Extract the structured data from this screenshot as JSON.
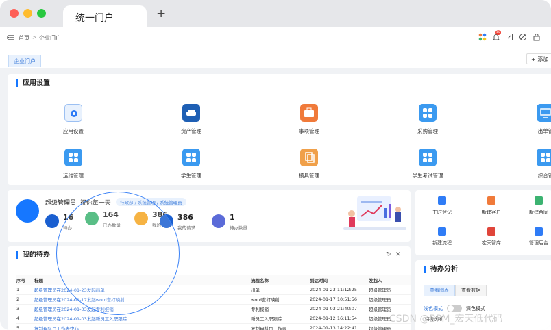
{
  "window": {
    "tab_title": "统一门户",
    "new_tab": "+"
  },
  "breadcrumb": {
    "home": "首页",
    "sep": ">",
    "current": "企业门户"
  },
  "topbar": {
    "notify_count": "98"
  },
  "page_tab": "企业门户",
  "add_button": "+ 添加",
  "app_settings": {
    "title": "应用设置",
    "apps": [
      {
        "label": "应用设置",
        "icon": "gear-icon",
        "color": "#e8f1fd"
      },
      {
        "label": "资产管理",
        "icon": "car-icon",
        "color": "#1e5fb4"
      },
      {
        "label": "事项管理",
        "icon": "briefcase-icon",
        "color": "#f07a3a"
      },
      {
        "label": "采购管理",
        "icon": "grid-icon",
        "color": "#3b9af0"
      },
      {
        "label": "出单管",
        "icon": "monitor-icon",
        "color": "#3b9af0"
      },
      {
        "label": "运维管理",
        "icon": "grid-icon",
        "color": "#3b9af0"
      },
      {
        "label": "学生管理",
        "icon": "grid-icon",
        "color": "#3b9af0"
      },
      {
        "label": "模具管理",
        "icon": "copy-icon",
        "color": "#f0a04a"
      },
      {
        "label": "学生考试管理",
        "icon": "grid-icon",
        "color": "#3b9af0"
      },
      {
        "label": "综合管",
        "icon": "grid-icon",
        "color": "#3b9af0"
      }
    ]
  },
  "welcome": {
    "greeting": "超级管理员, 祝你每一天!",
    "roles": "行政部 / 系统管理 / 系统管理员"
  },
  "stats": [
    {
      "value": "16",
      "label": "待办",
      "color": "#1a5fd0"
    },
    {
      "value": "164",
      "label": "已办数量",
      "color": "#3cb371"
    },
    {
      "value": "386",
      "label": "我的请求",
      "color": "#f5a623"
    },
    {
      "value": "386",
      "label": "我的请求",
      "color": "#1a5fd0"
    },
    {
      "value": "1",
      "label": "待办数量",
      "color": "#5b6bd8"
    }
  ],
  "quick_links": [
    {
      "label": "工时登记",
      "color": "#2f7cf6"
    },
    {
      "label": "新建客户",
      "color": "#f07a3a"
    },
    {
      "label": "新建合同",
      "color": "#3cb371"
    },
    {
      "label": "新建流程",
      "color": "#2f7cf6"
    },
    {
      "label": "宏天智库",
      "color": "#e0453a"
    },
    {
      "label": "管理后台",
      "color": "#2f7cf6"
    }
  ],
  "todo": {
    "title": "我的待办",
    "columns": [
      "序号",
      "标题",
      "流程名称",
      "到达时间",
      "发起人"
    ],
    "rows": [
      [
        "1",
        "超级管理员在2024-01-23发起出单",
        "出单",
        "2024-01-23 11:12:25",
        "超级管理员"
      ],
      [
        "2",
        "超级管理员在2024-01-17发起word套打映射",
        "word套打映射",
        "2024-01-17 10:51:56",
        "超级管理员"
      ],
      [
        "3",
        "超级管理员在2024-01-03发起专利报销",
        "专利报销",
        "2024-01-03 21:40:07",
        "超级管理员"
      ],
      [
        "4",
        "超级管理员在2024-01-03发起新员工入职跟踪",
        "新员工入职跟踪",
        "2024-01-12 16:11:54",
        "超级管理员"
      ],
      [
        "5",
        "复制母科目工作表中心",
        "复制母科目工作表",
        "2024-01-13 14:22:41",
        "超级管理员"
      ]
    ]
  },
  "analysis": {
    "title": "待办分析",
    "tab1": "查看图表",
    "tab2": "查看数据",
    "light_mode": "浅色模式",
    "dark_mode": "深色模式",
    "sub": "待办分析"
  },
  "watermark": "CSDN @BPM_宏天低代码"
}
